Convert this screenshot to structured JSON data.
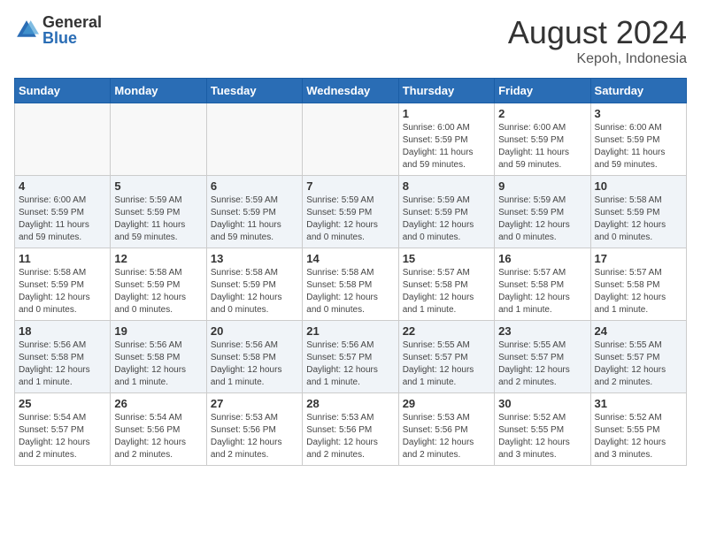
{
  "header": {
    "logo_general": "General",
    "logo_blue": "Blue",
    "month_title": "August 2024",
    "location": "Kepoh, Indonesia"
  },
  "weekdays": [
    "Sunday",
    "Monday",
    "Tuesday",
    "Wednesday",
    "Thursday",
    "Friday",
    "Saturday"
  ],
  "weeks": [
    [
      {
        "day": "",
        "info": ""
      },
      {
        "day": "",
        "info": ""
      },
      {
        "day": "",
        "info": ""
      },
      {
        "day": "",
        "info": ""
      },
      {
        "day": "1",
        "info": "Sunrise: 6:00 AM\nSunset: 5:59 PM\nDaylight: 11 hours\nand 59 minutes."
      },
      {
        "day": "2",
        "info": "Sunrise: 6:00 AM\nSunset: 5:59 PM\nDaylight: 11 hours\nand 59 minutes."
      },
      {
        "day": "3",
        "info": "Sunrise: 6:00 AM\nSunset: 5:59 PM\nDaylight: 11 hours\nand 59 minutes."
      }
    ],
    [
      {
        "day": "4",
        "info": "Sunrise: 6:00 AM\nSunset: 5:59 PM\nDaylight: 11 hours\nand 59 minutes."
      },
      {
        "day": "5",
        "info": "Sunrise: 5:59 AM\nSunset: 5:59 PM\nDaylight: 11 hours\nand 59 minutes."
      },
      {
        "day": "6",
        "info": "Sunrise: 5:59 AM\nSunset: 5:59 PM\nDaylight: 11 hours\nand 59 minutes."
      },
      {
        "day": "7",
        "info": "Sunrise: 5:59 AM\nSunset: 5:59 PM\nDaylight: 12 hours\nand 0 minutes."
      },
      {
        "day": "8",
        "info": "Sunrise: 5:59 AM\nSunset: 5:59 PM\nDaylight: 12 hours\nand 0 minutes."
      },
      {
        "day": "9",
        "info": "Sunrise: 5:59 AM\nSunset: 5:59 PM\nDaylight: 12 hours\nand 0 minutes."
      },
      {
        "day": "10",
        "info": "Sunrise: 5:58 AM\nSunset: 5:59 PM\nDaylight: 12 hours\nand 0 minutes."
      }
    ],
    [
      {
        "day": "11",
        "info": "Sunrise: 5:58 AM\nSunset: 5:59 PM\nDaylight: 12 hours\nand 0 minutes."
      },
      {
        "day": "12",
        "info": "Sunrise: 5:58 AM\nSunset: 5:59 PM\nDaylight: 12 hours\nand 0 minutes."
      },
      {
        "day": "13",
        "info": "Sunrise: 5:58 AM\nSunset: 5:59 PM\nDaylight: 12 hours\nand 0 minutes."
      },
      {
        "day": "14",
        "info": "Sunrise: 5:58 AM\nSunset: 5:58 PM\nDaylight: 12 hours\nand 0 minutes."
      },
      {
        "day": "15",
        "info": "Sunrise: 5:57 AM\nSunset: 5:58 PM\nDaylight: 12 hours\nand 1 minute."
      },
      {
        "day": "16",
        "info": "Sunrise: 5:57 AM\nSunset: 5:58 PM\nDaylight: 12 hours\nand 1 minute."
      },
      {
        "day": "17",
        "info": "Sunrise: 5:57 AM\nSunset: 5:58 PM\nDaylight: 12 hours\nand 1 minute."
      }
    ],
    [
      {
        "day": "18",
        "info": "Sunrise: 5:56 AM\nSunset: 5:58 PM\nDaylight: 12 hours\nand 1 minute."
      },
      {
        "day": "19",
        "info": "Sunrise: 5:56 AM\nSunset: 5:58 PM\nDaylight: 12 hours\nand 1 minute."
      },
      {
        "day": "20",
        "info": "Sunrise: 5:56 AM\nSunset: 5:58 PM\nDaylight: 12 hours\nand 1 minute."
      },
      {
        "day": "21",
        "info": "Sunrise: 5:56 AM\nSunset: 5:57 PM\nDaylight: 12 hours\nand 1 minute."
      },
      {
        "day": "22",
        "info": "Sunrise: 5:55 AM\nSunset: 5:57 PM\nDaylight: 12 hours\nand 1 minute."
      },
      {
        "day": "23",
        "info": "Sunrise: 5:55 AM\nSunset: 5:57 PM\nDaylight: 12 hours\nand 2 minutes."
      },
      {
        "day": "24",
        "info": "Sunrise: 5:55 AM\nSunset: 5:57 PM\nDaylight: 12 hours\nand 2 minutes."
      }
    ],
    [
      {
        "day": "25",
        "info": "Sunrise: 5:54 AM\nSunset: 5:57 PM\nDaylight: 12 hours\nand 2 minutes."
      },
      {
        "day": "26",
        "info": "Sunrise: 5:54 AM\nSunset: 5:56 PM\nDaylight: 12 hours\nand 2 minutes."
      },
      {
        "day": "27",
        "info": "Sunrise: 5:53 AM\nSunset: 5:56 PM\nDaylight: 12 hours\nand 2 minutes."
      },
      {
        "day": "28",
        "info": "Sunrise: 5:53 AM\nSunset: 5:56 PM\nDaylight: 12 hours\nand 2 minutes."
      },
      {
        "day": "29",
        "info": "Sunrise: 5:53 AM\nSunset: 5:56 PM\nDaylight: 12 hours\nand 2 minutes."
      },
      {
        "day": "30",
        "info": "Sunrise: 5:52 AM\nSunset: 5:55 PM\nDaylight: 12 hours\nand 3 minutes."
      },
      {
        "day": "31",
        "info": "Sunrise: 5:52 AM\nSunset: 5:55 PM\nDaylight: 12 hours\nand 3 minutes."
      }
    ]
  ]
}
